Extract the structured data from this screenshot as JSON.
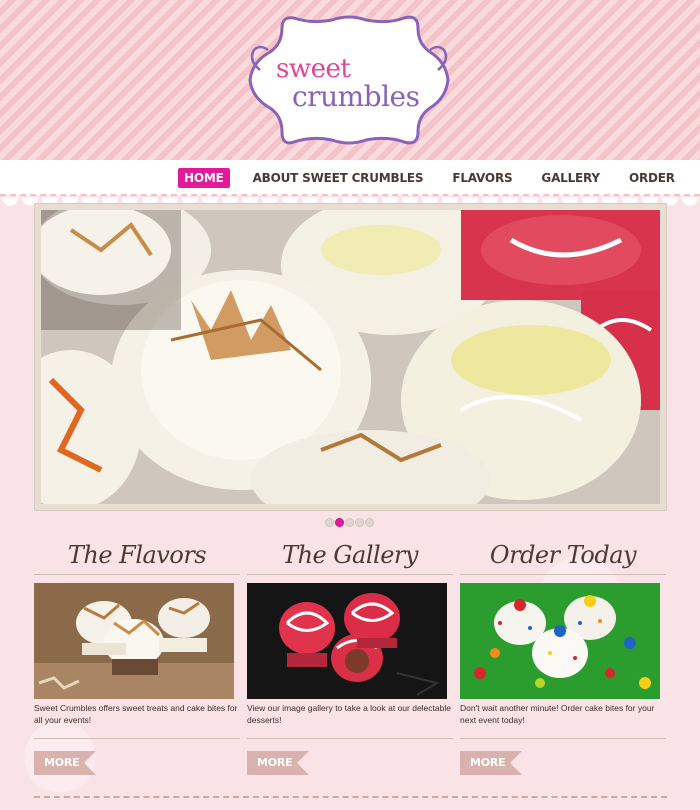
{
  "logo": {
    "word1": "sweet",
    "word2": "crumbles"
  },
  "nav": {
    "items": [
      {
        "label": "HOME",
        "active": true
      },
      {
        "label": "ABOUT SWEET CRUMBLES",
        "active": false
      },
      {
        "label": "FLAVORS",
        "active": false
      },
      {
        "label": "GALLERY",
        "active": false
      },
      {
        "label": "ORDER",
        "active": false
      }
    ]
  },
  "slider": {
    "dots": 5,
    "active_index": 1
  },
  "columns": [
    {
      "title": "The Flavors",
      "text": "Sweet Crumbles offers sweet treats and cake bites for all your events!",
      "more": "MORE"
    },
    {
      "title": "The Gallery",
      "text": "View our image gallery to take a look at our delectable desserts!",
      "more": "MORE"
    },
    {
      "title": "Order Today",
      "text": "Don't wait another minute! Order cake bites for your next event today!",
      "more": "MORE"
    }
  ],
  "colors": {
    "accent": "#e4189a",
    "nav_text": "#4a3a35",
    "logo_pink": "#e0449b",
    "logo_purple": "#8a63b8",
    "more_button": "#d9b2ae"
  }
}
